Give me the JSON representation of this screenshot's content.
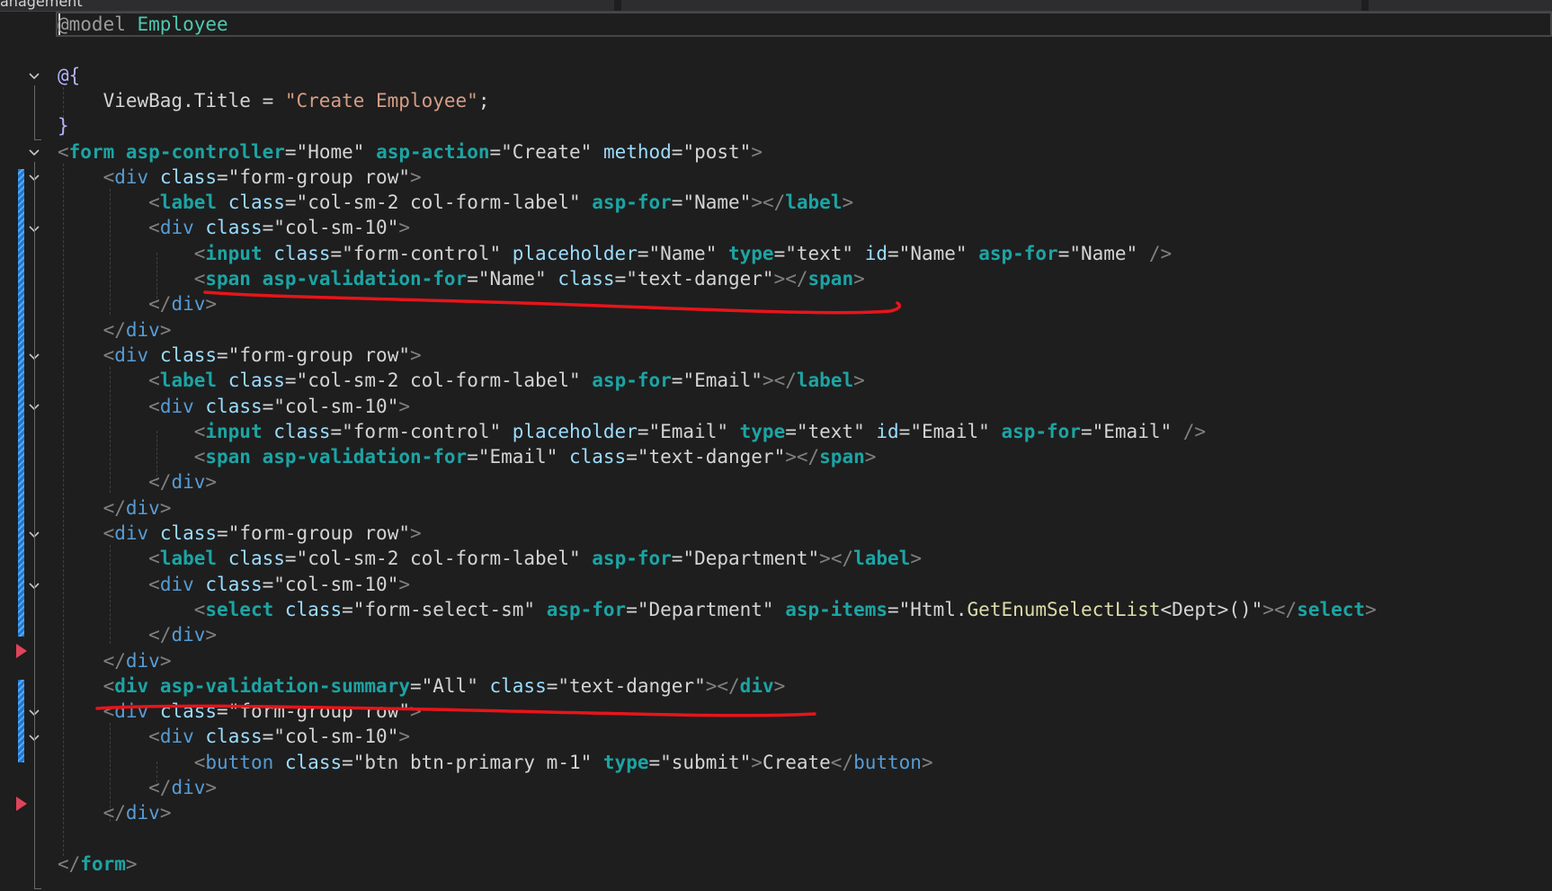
{
  "window": {
    "tab_label": "anagement"
  },
  "colors": {
    "background": "#1e1e1e",
    "change_bar": "#1e78d2",
    "annotation": "#e8141a",
    "breakpoint_arrow": "#e0445a"
  },
  "icons": {
    "fold": "chevron-down-icon",
    "breakpoint": "breakpoint-arrow-icon"
  },
  "code_lines": [
    [
      {
        "t": "@model ",
        "c": "c-dir"
      },
      {
        "t": "Employee",
        "c": "c-type"
      }
    ],
    [],
    [
      {
        "t": "@{",
        "c": "c-razor"
      }
    ],
    [
      {
        "t": "    ViewBag.Title ",
        "c": "c-val"
      },
      {
        "t": "= ",
        "c": "c-punct"
      },
      {
        "t": "\"Create Employee\"",
        "c": "c-str"
      },
      {
        "t": ";",
        "c": "c-punct"
      }
    ],
    [
      {
        "t": "}",
        "c": "c-razor"
      }
    ],
    [
      {
        "t": "<",
        "c": "c-bracket"
      },
      {
        "t": "form",
        "c": "c-thelper"
      },
      {
        "t": " ",
        "c": "c-val"
      },
      {
        "t": "asp-controller",
        "c": "c-thelper"
      },
      {
        "t": "=\"Home\" ",
        "c": "c-val"
      },
      {
        "t": "asp-action",
        "c": "c-thelper"
      },
      {
        "t": "=\"Create\" ",
        "c": "c-val"
      },
      {
        "t": "method",
        "c": "c-attr"
      },
      {
        "t": "=\"post\"",
        "c": "c-val"
      },
      {
        "t": ">",
        "c": "c-bracket"
      }
    ],
    [
      {
        "t": "    ",
        "c": "c-val"
      },
      {
        "t": "<",
        "c": "c-bracket"
      },
      {
        "t": "div",
        "c": "c-tag"
      },
      {
        "t": " ",
        "c": "c-val"
      },
      {
        "t": "class",
        "c": "c-attr"
      },
      {
        "t": "=\"form-group row\"",
        "c": "c-val"
      },
      {
        "t": ">",
        "c": "c-bracket"
      }
    ],
    [
      {
        "t": "        ",
        "c": "c-val"
      },
      {
        "t": "<",
        "c": "c-bracket"
      },
      {
        "t": "label",
        "c": "c-thelper"
      },
      {
        "t": " ",
        "c": "c-val"
      },
      {
        "t": "class",
        "c": "c-attr"
      },
      {
        "t": "=\"col-sm-2 col-form-label\" ",
        "c": "c-val"
      },
      {
        "t": "asp-for",
        "c": "c-thelper"
      },
      {
        "t": "=\"Name\"",
        "c": "c-val"
      },
      {
        "t": "></",
        "c": "c-bracket"
      },
      {
        "t": "label",
        "c": "c-thelper"
      },
      {
        "t": ">",
        "c": "c-bracket"
      }
    ],
    [
      {
        "t": "        ",
        "c": "c-val"
      },
      {
        "t": "<",
        "c": "c-bracket"
      },
      {
        "t": "div",
        "c": "c-tag"
      },
      {
        "t": " ",
        "c": "c-val"
      },
      {
        "t": "class",
        "c": "c-attr"
      },
      {
        "t": "=\"col-sm-10\"",
        "c": "c-val"
      },
      {
        "t": ">",
        "c": "c-bracket"
      }
    ],
    [
      {
        "t": "            ",
        "c": "c-val"
      },
      {
        "t": "<",
        "c": "c-bracket"
      },
      {
        "t": "input",
        "c": "c-thelper"
      },
      {
        "t": " ",
        "c": "c-val"
      },
      {
        "t": "class",
        "c": "c-attr"
      },
      {
        "t": "=\"form-control\" ",
        "c": "c-val"
      },
      {
        "t": "placeholder",
        "c": "c-attr"
      },
      {
        "t": "=\"Name\" ",
        "c": "c-val"
      },
      {
        "t": "type",
        "c": "c-thelper"
      },
      {
        "t": "=\"text\" ",
        "c": "c-val"
      },
      {
        "t": "id",
        "c": "c-attr"
      },
      {
        "t": "=\"Name\" ",
        "c": "c-val"
      },
      {
        "t": "asp-for",
        "c": "c-thelper"
      },
      {
        "t": "=\"Name\" ",
        "c": "c-val"
      },
      {
        "t": "/>",
        "c": "c-bracket"
      }
    ],
    [
      {
        "t": "            ",
        "c": "c-val"
      },
      {
        "t": "<",
        "c": "c-bracket"
      },
      {
        "t": "span",
        "c": "c-thelper"
      },
      {
        "t": " ",
        "c": "c-val"
      },
      {
        "t": "asp-validation-for",
        "c": "c-thelper"
      },
      {
        "t": "=\"Name\" ",
        "c": "c-val"
      },
      {
        "t": "class",
        "c": "c-attr"
      },
      {
        "t": "=\"text-danger\"",
        "c": "c-val"
      },
      {
        "t": "></",
        "c": "c-bracket"
      },
      {
        "t": "span",
        "c": "c-thelper"
      },
      {
        "t": ">",
        "c": "c-bracket"
      }
    ],
    [
      {
        "t": "        ",
        "c": "c-val"
      },
      {
        "t": "</",
        "c": "c-bracket"
      },
      {
        "t": "div",
        "c": "c-tag"
      },
      {
        "t": ">",
        "c": "c-bracket"
      }
    ],
    [
      {
        "t": "    ",
        "c": "c-val"
      },
      {
        "t": "</",
        "c": "c-bracket"
      },
      {
        "t": "div",
        "c": "c-tag"
      },
      {
        "t": ">",
        "c": "c-bracket"
      }
    ],
    [
      {
        "t": "    ",
        "c": "c-val"
      },
      {
        "t": "<",
        "c": "c-bracket"
      },
      {
        "t": "div",
        "c": "c-tag"
      },
      {
        "t": " ",
        "c": "c-val"
      },
      {
        "t": "class",
        "c": "c-attr"
      },
      {
        "t": "=\"form-group row\"",
        "c": "c-val"
      },
      {
        "t": ">",
        "c": "c-bracket"
      }
    ],
    [
      {
        "t": "        ",
        "c": "c-val"
      },
      {
        "t": "<",
        "c": "c-bracket"
      },
      {
        "t": "label",
        "c": "c-thelper"
      },
      {
        "t": " ",
        "c": "c-val"
      },
      {
        "t": "class",
        "c": "c-attr"
      },
      {
        "t": "=\"col-sm-2 col-form-label\" ",
        "c": "c-val"
      },
      {
        "t": "asp-for",
        "c": "c-thelper"
      },
      {
        "t": "=\"Email\"",
        "c": "c-val"
      },
      {
        "t": "></",
        "c": "c-bracket"
      },
      {
        "t": "label",
        "c": "c-thelper"
      },
      {
        "t": ">",
        "c": "c-bracket"
      }
    ],
    [
      {
        "t": "        ",
        "c": "c-val"
      },
      {
        "t": "<",
        "c": "c-bracket"
      },
      {
        "t": "div",
        "c": "c-tag"
      },
      {
        "t": " ",
        "c": "c-val"
      },
      {
        "t": "class",
        "c": "c-attr"
      },
      {
        "t": "=\"col-sm-10\"",
        "c": "c-val"
      },
      {
        "t": ">",
        "c": "c-bracket"
      }
    ],
    [
      {
        "t": "            ",
        "c": "c-val"
      },
      {
        "t": "<",
        "c": "c-bracket"
      },
      {
        "t": "input",
        "c": "c-thelper"
      },
      {
        "t": " ",
        "c": "c-val"
      },
      {
        "t": "class",
        "c": "c-attr"
      },
      {
        "t": "=\"form-control\" ",
        "c": "c-val"
      },
      {
        "t": "placeholder",
        "c": "c-attr"
      },
      {
        "t": "=\"Email\" ",
        "c": "c-val"
      },
      {
        "t": "type",
        "c": "c-thelper"
      },
      {
        "t": "=\"text\" ",
        "c": "c-val"
      },
      {
        "t": "id",
        "c": "c-attr"
      },
      {
        "t": "=\"Email\" ",
        "c": "c-val"
      },
      {
        "t": "asp-for",
        "c": "c-thelper"
      },
      {
        "t": "=\"Email\" ",
        "c": "c-val"
      },
      {
        "t": "/>",
        "c": "c-bracket"
      }
    ],
    [
      {
        "t": "            ",
        "c": "c-val"
      },
      {
        "t": "<",
        "c": "c-bracket"
      },
      {
        "t": "span",
        "c": "c-thelper"
      },
      {
        "t": " ",
        "c": "c-val"
      },
      {
        "t": "asp-validation-for",
        "c": "c-thelper"
      },
      {
        "t": "=\"Email\" ",
        "c": "c-val"
      },
      {
        "t": "class",
        "c": "c-attr"
      },
      {
        "t": "=\"text-danger\"",
        "c": "c-val"
      },
      {
        "t": "></",
        "c": "c-bracket"
      },
      {
        "t": "span",
        "c": "c-thelper"
      },
      {
        "t": ">",
        "c": "c-bracket"
      }
    ],
    [
      {
        "t": "        ",
        "c": "c-val"
      },
      {
        "t": "</",
        "c": "c-bracket"
      },
      {
        "t": "div",
        "c": "c-tag"
      },
      {
        "t": ">",
        "c": "c-bracket"
      }
    ],
    [
      {
        "t": "    ",
        "c": "c-val"
      },
      {
        "t": "</",
        "c": "c-bracket"
      },
      {
        "t": "div",
        "c": "c-tag"
      },
      {
        "t": ">",
        "c": "c-bracket"
      }
    ],
    [
      {
        "t": "    ",
        "c": "c-val"
      },
      {
        "t": "<",
        "c": "c-bracket"
      },
      {
        "t": "div",
        "c": "c-tag"
      },
      {
        "t": " ",
        "c": "c-val"
      },
      {
        "t": "class",
        "c": "c-attr"
      },
      {
        "t": "=\"form-group row\"",
        "c": "c-val"
      },
      {
        "t": ">",
        "c": "c-bracket"
      }
    ],
    [
      {
        "t": "        ",
        "c": "c-val"
      },
      {
        "t": "<",
        "c": "c-bracket"
      },
      {
        "t": "label",
        "c": "c-thelper"
      },
      {
        "t": " ",
        "c": "c-val"
      },
      {
        "t": "class",
        "c": "c-attr"
      },
      {
        "t": "=\"col-sm-2 col-form-label\" ",
        "c": "c-val"
      },
      {
        "t": "asp-for",
        "c": "c-thelper"
      },
      {
        "t": "=\"Department\"",
        "c": "c-val"
      },
      {
        "t": "></",
        "c": "c-bracket"
      },
      {
        "t": "label",
        "c": "c-thelper"
      },
      {
        "t": ">",
        "c": "c-bracket"
      }
    ],
    [
      {
        "t": "        ",
        "c": "c-val"
      },
      {
        "t": "<",
        "c": "c-bracket"
      },
      {
        "t": "div",
        "c": "c-tag"
      },
      {
        "t": " ",
        "c": "c-val"
      },
      {
        "t": "class",
        "c": "c-attr"
      },
      {
        "t": "=\"col-sm-10\"",
        "c": "c-val"
      },
      {
        "t": ">",
        "c": "c-bracket"
      }
    ],
    [
      {
        "t": "            ",
        "c": "c-val"
      },
      {
        "t": "<",
        "c": "c-bracket"
      },
      {
        "t": "select",
        "c": "c-thelper"
      },
      {
        "t": " ",
        "c": "c-val"
      },
      {
        "t": "class",
        "c": "c-attr"
      },
      {
        "t": "=\"form-select-sm\" ",
        "c": "c-val"
      },
      {
        "t": "asp-for",
        "c": "c-thelper"
      },
      {
        "t": "=\"Department\" ",
        "c": "c-val"
      },
      {
        "t": "asp-items",
        "c": "c-thelper"
      },
      {
        "t": "=\"Html.",
        "c": "c-val"
      },
      {
        "t": "GetEnumSelectList",
        "c": "c-meth"
      },
      {
        "t": "<Dept>()\"",
        "c": "c-val"
      },
      {
        "t": "></",
        "c": "c-bracket"
      },
      {
        "t": "select",
        "c": "c-thelper"
      },
      {
        "t": ">",
        "c": "c-bracket"
      }
    ],
    [
      {
        "t": "        ",
        "c": "c-val"
      },
      {
        "t": "</",
        "c": "c-bracket"
      },
      {
        "t": "div",
        "c": "c-tag"
      },
      {
        "t": ">",
        "c": "c-bracket"
      }
    ],
    [
      {
        "t": "    ",
        "c": "c-val"
      },
      {
        "t": "</",
        "c": "c-bracket"
      },
      {
        "t": "div",
        "c": "c-tag"
      },
      {
        "t": ">",
        "c": "c-bracket"
      }
    ],
    [
      {
        "t": "    ",
        "c": "c-val"
      },
      {
        "t": "<",
        "c": "c-bracket"
      },
      {
        "t": "div",
        "c": "c-thelper"
      },
      {
        "t": " ",
        "c": "c-val"
      },
      {
        "t": "asp-validation-summary",
        "c": "c-thelper"
      },
      {
        "t": "=\"All\" ",
        "c": "c-val"
      },
      {
        "t": "class",
        "c": "c-attr"
      },
      {
        "t": "=\"text-danger\"",
        "c": "c-val"
      },
      {
        "t": "></",
        "c": "c-bracket"
      },
      {
        "t": "div",
        "c": "c-thelper"
      },
      {
        "t": ">",
        "c": "c-bracket"
      }
    ],
    [
      {
        "t": "    ",
        "c": "c-val"
      },
      {
        "t": "<",
        "c": "c-bracket"
      },
      {
        "t": "div",
        "c": "c-tag"
      },
      {
        "t": " ",
        "c": "c-val"
      },
      {
        "t": "class",
        "c": "c-attr"
      },
      {
        "t": "=\"form-group row\"",
        "c": "c-val"
      },
      {
        "t": ">",
        "c": "c-bracket"
      }
    ],
    [
      {
        "t": "        ",
        "c": "c-val"
      },
      {
        "t": "<",
        "c": "c-bracket"
      },
      {
        "t": "div",
        "c": "c-tag"
      },
      {
        "t": " ",
        "c": "c-val"
      },
      {
        "t": "class",
        "c": "c-attr"
      },
      {
        "t": "=\"col-sm-10\"",
        "c": "c-val"
      },
      {
        "t": ">",
        "c": "c-bracket"
      }
    ],
    [
      {
        "t": "            ",
        "c": "c-val"
      },
      {
        "t": "<",
        "c": "c-bracket"
      },
      {
        "t": "button",
        "c": "c-tag"
      },
      {
        "t": " ",
        "c": "c-val"
      },
      {
        "t": "class",
        "c": "c-attr"
      },
      {
        "t": "=\"btn btn-primary m-1\" ",
        "c": "c-val"
      },
      {
        "t": "type",
        "c": "c-thelper"
      },
      {
        "t": "=\"submit\"",
        "c": "c-val"
      },
      {
        "t": ">",
        "c": "c-bracket"
      },
      {
        "t": "Create",
        "c": "c-val"
      },
      {
        "t": "</",
        "c": "c-bracket"
      },
      {
        "t": "button",
        "c": "c-tag"
      },
      {
        "t": ">",
        "c": "c-bracket"
      }
    ],
    [
      {
        "t": "        ",
        "c": "c-val"
      },
      {
        "t": "</",
        "c": "c-bracket"
      },
      {
        "t": "div",
        "c": "c-tag"
      },
      {
        "t": ">",
        "c": "c-bracket"
      }
    ],
    [
      {
        "t": "    ",
        "c": "c-val"
      },
      {
        "t": "</",
        "c": "c-bracket"
      },
      {
        "t": "div",
        "c": "c-tag"
      },
      {
        "t": ">",
        "c": "c-bracket"
      }
    ],
    [],
    [
      {
        "t": "</",
        "c": "c-bracket"
      },
      {
        "t": "form",
        "c": "c-thelper"
      },
      {
        "t": ">",
        "c": "c-bracket"
      }
    ]
  ]
}
